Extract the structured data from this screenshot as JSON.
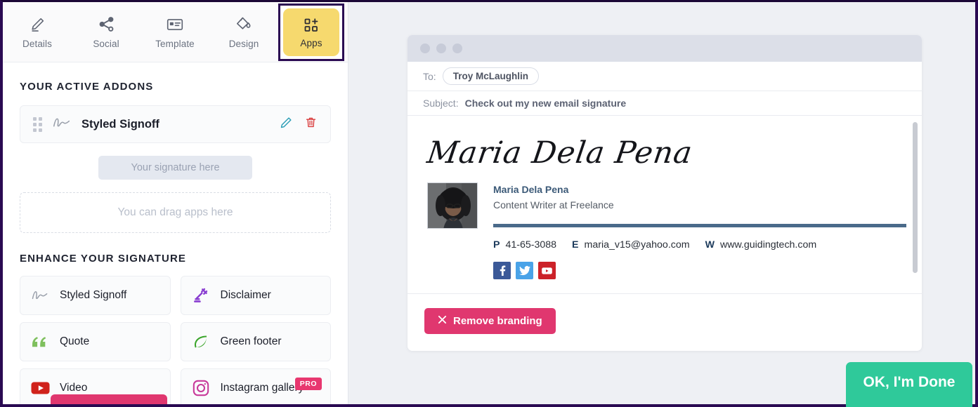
{
  "toolbar": {
    "tabs": [
      {
        "label": "Details",
        "icon": "pencil-edit-icon",
        "active": false
      },
      {
        "label": "Social",
        "icon": "share-nodes-icon",
        "active": false
      },
      {
        "label": "Template",
        "icon": "id-card-icon",
        "active": false
      },
      {
        "label": "Design",
        "icon": "paint-bucket-icon",
        "active": false
      },
      {
        "label": "Apps",
        "icon": "apps-grid-plus-icon",
        "active": true
      }
    ],
    "active_tab_highlight_bg": "#f6d96e",
    "active_tab_outline": "#2a0a52"
  },
  "sidebar": {
    "active_addons_title": "YOUR ACTIVE ADDONS",
    "active_addon": {
      "name": "Styled Signoff",
      "drag_handle_icon": "drag-dots-icon",
      "type_icon": "signature-squiggle-icon",
      "edit_icon": "pencil-icon",
      "edit_icon_color": "#2a9db5",
      "delete_icon": "trash-icon",
      "delete_icon_color": "#d93a3a"
    },
    "signature_chip": "Your signature here",
    "dropzone_text": "You can drag apps here",
    "enhance_title": "ENHANCE YOUR SIGNATURE",
    "enhance_items": [
      {
        "label": "Styled Signoff",
        "icon": "signature-squiggle-icon",
        "pro": false
      },
      {
        "label": "Disclaimer",
        "icon": "gavel-icon",
        "pro": false
      },
      {
        "label": "Quote",
        "icon": "quote-marks-icon",
        "pro": false
      },
      {
        "label": "Green footer",
        "icon": "leaf-icon",
        "pro": false
      },
      {
        "label": "Video",
        "icon": "youtube-play-icon",
        "pro": false
      },
      {
        "label": "Instagram gallery",
        "icon": "instagram-icon",
        "pro": true,
        "pro_label": "PRO"
      }
    ]
  },
  "preview": {
    "window_dots": [
      "dot",
      "dot",
      "dot"
    ],
    "to_label": "To:",
    "to_value": "Troy McLaughlin",
    "subject_label": "Subject:",
    "subject_value": "Check out my new email signature",
    "signature": {
      "handwritten_name": "Maria Dela Pena",
      "avatar_alt": "avatar",
      "name": "Maria Dela Pena",
      "title": "Content Writer at Freelance",
      "rule_color": "#4a6a8a",
      "contacts": [
        {
          "key": "P",
          "value": "41-65-3088"
        },
        {
          "key": "E",
          "value": "maria_v15@yahoo.com"
        },
        {
          "key": "W",
          "value": "www.guidingtech.com"
        }
      ],
      "social": [
        {
          "name": "facebook-icon",
          "glyph": "f",
          "color": "#3b5998"
        },
        {
          "name": "twitter-icon",
          "glyph": "t",
          "color": "#4aa3e8"
        },
        {
          "name": "youtube-icon",
          "glyph": "y",
          "color": "#cc2229"
        }
      ]
    },
    "remove_branding_label": "Remove branding",
    "remove_branding_icon": "close-x-icon",
    "remove_branding_color": "#e0376f"
  },
  "footer": {
    "done_label": "OK, I'm Done",
    "done_color": "#2fc99a"
  }
}
